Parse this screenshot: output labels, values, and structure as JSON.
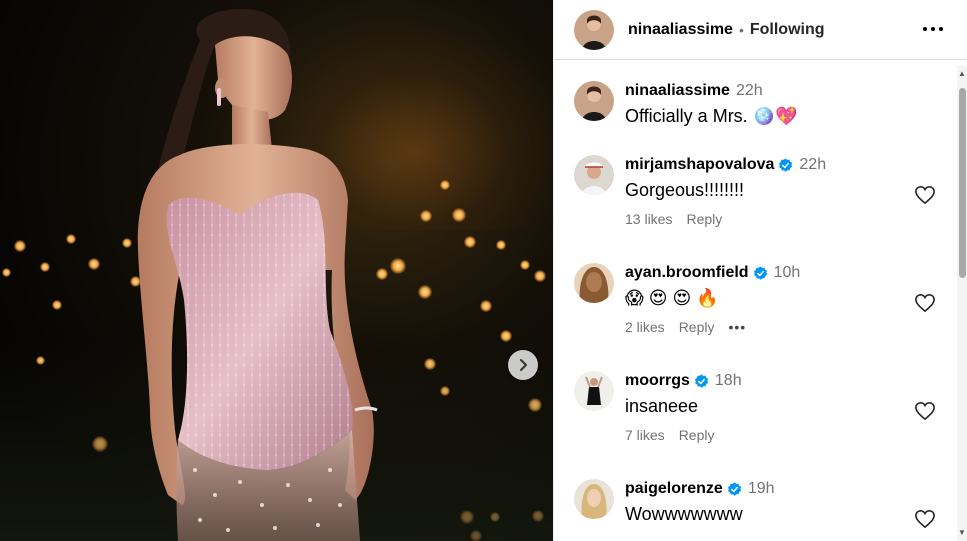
{
  "post": {
    "author": "nin‍aaliassime",
    "separator": "•",
    "follow_status": "Following"
  },
  "icons": {
    "more": "more-horizontal-icon",
    "next": "chevron-right-icon",
    "like": "heart-outline-icon",
    "verified": "verified-badge-icon"
  },
  "colors": {
    "verified": "#0095f6",
    "secondary_text": "#737373"
  },
  "comments": [
    {
      "username": "ninaaliassime",
      "verified": false,
      "time": "22h",
      "text": "Officially a Mrs. 🪩💖"
    },
    {
      "username": "mirjamshapovalova",
      "verified": true,
      "time": "22h",
      "text": "Gorgeous!!!!!!!!",
      "likes": "13 likes",
      "reply": "Reply"
    },
    {
      "username": "ayan.broomfield",
      "verified": true,
      "time": "10h",
      "text": "😱 😍 😍 🔥",
      "likes": "2 likes",
      "reply": "Reply",
      "more": "•••"
    },
    {
      "username": "moorrgs",
      "verified": true,
      "time": "18h",
      "text": "insaneee",
      "likes": "7 likes",
      "reply": "Reply"
    },
    {
      "username": "paigelorenze",
      "verified": true,
      "time": "19h",
      "text": "Wowwwwwww"
    }
  ]
}
